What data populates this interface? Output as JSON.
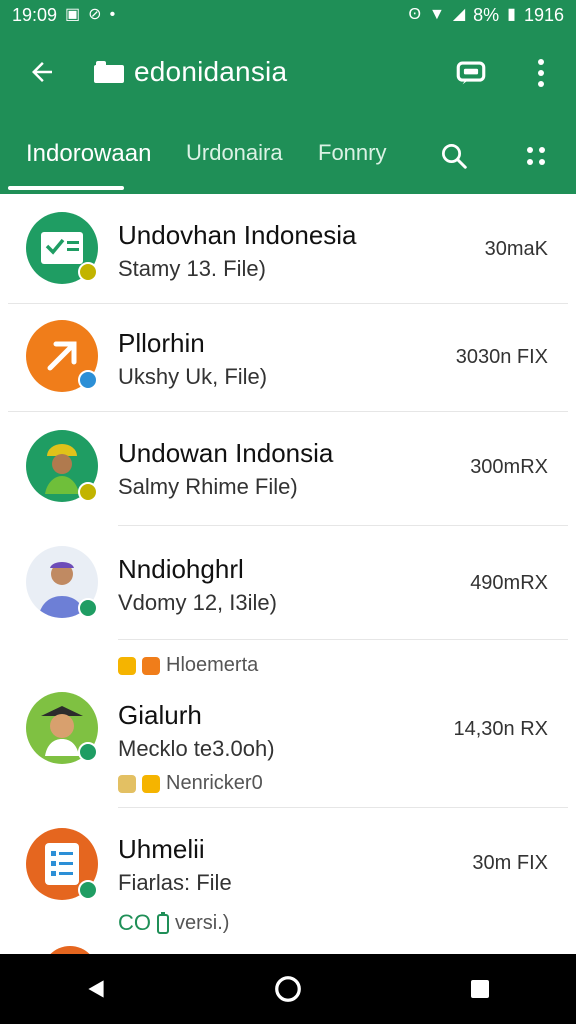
{
  "status": {
    "time": "19:09",
    "battery": "8%",
    "right_time": "1916"
  },
  "appbar": {
    "title": "edonidansia"
  },
  "tabs": [
    {
      "label": "Indorowaan"
    },
    {
      "label": "Urdonaira"
    },
    {
      "label": "Fonnry"
    }
  ],
  "items": [
    {
      "title": "Undovhan Indonesia",
      "subtitle": "Stamy 13. File)",
      "meta": "30maK"
    },
    {
      "title": "Pllorhin",
      "subtitle": "Ukshy Uk, File)",
      "meta": "3030n FIX"
    },
    {
      "title": "Undowan Indonsia",
      "subtitle": "Salmy Rhime File)",
      "meta": "300mRX"
    },
    {
      "title": "Nndiohghrl",
      "subtitle": "Vdomy 12, I3ile)",
      "meta": "490mRX"
    },
    {
      "pre_tag": "Hloemerta",
      "title": "Gialurh",
      "subtitle": "Mecklo te3.0oh)",
      "meta": "14,30n RX",
      "post_tag": "Nenricker0"
    },
    {
      "title": "Uhmelii",
      "subtitle": "Fiarlas: File",
      "meta": "30m FIX",
      "extra_label": "CO",
      "extra_tail": "versi.)"
    }
  ]
}
